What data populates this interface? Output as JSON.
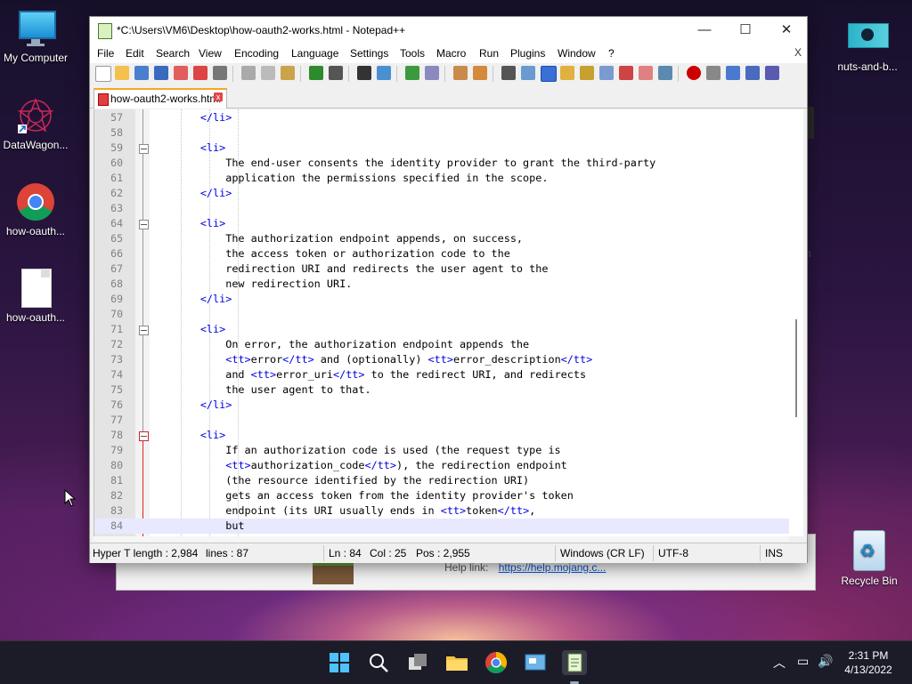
{
  "desktop": {
    "icons": [
      {
        "label": "My Computer",
        "icon": "monitor-icon"
      },
      {
        "label": "DataWagon...",
        "icon": "datawagon-shortcut-icon"
      },
      {
        "label": "how-oauth...",
        "icon": "chrome-icon"
      },
      {
        "label": "how-oauth...",
        "icon": "file-icon"
      },
      {
        "label": "nuts-and-b...",
        "icon": "image-file-icon"
      }
    ],
    "recycle_bin": "Recycle Bin"
  },
  "background_window": {
    "help_label": "Help link:",
    "help_link": "https://help.mojang.c...",
    "edge_text": "n"
  },
  "notepad": {
    "title": "*C:\\Users\\VM6\\Desktop\\how-oauth2-works.html - Notepad++",
    "menu": [
      "File",
      "Edit",
      "Search",
      "View",
      "Encoding",
      "Language",
      "Settings",
      "Tools",
      "Macro",
      "Run",
      "Plugins",
      "Window",
      "?"
    ],
    "menu_close": "X",
    "tab": {
      "name": "how-oauth2-works.html",
      "close": "x"
    },
    "lines": [
      {
        "n": "57",
        "text": "        </li>"
      },
      {
        "n": "58",
        "text": ""
      },
      {
        "n": "59",
        "text": "        <li>"
      },
      {
        "n": "60",
        "text": "            The end-user consents the identity provider to grant the third-party"
      },
      {
        "n": "61",
        "text": "            application the permissions specified in the scope."
      },
      {
        "n": "62",
        "text": "        </li>"
      },
      {
        "n": "63",
        "text": ""
      },
      {
        "n": "64",
        "text": "        <li>"
      },
      {
        "n": "65",
        "text": "            The authorization endpoint appends, on success,"
      },
      {
        "n": "66",
        "text": "            the access token or authorization code to the"
      },
      {
        "n": "67",
        "text": "            redirection URI and redirects the user agent to the"
      },
      {
        "n": "68",
        "text": "            new redirection URI."
      },
      {
        "n": "69",
        "text": "        </li>"
      },
      {
        "n": "70",
        "text": ""
      },
      {
        "n": "71",
        "text": "        <li>"
      },
      {
        "n": "72",
        "text": "            On error, the authorization endpoint appends the"
      },
      {
        "n": "73",
        "text": "            <tt>error</tt> and (optionally) <tt>error_description</tt>"
      },
      {
        "n": "74",
        "text": "            and <tt>error_uri</tt> to the redirect URI, and redirects"
      },
      {
        "n": "75",
        "text": "            the user agent to that."
      },
      {
        "n": "76",
        "text": "        </li>"
      },
      {
        "n": "77",
        "text": ""
      },
      {
        "n": "78",
        "text": "        <li>"
      },
      {
        "n": "79",
        "text": "            If an authorization code is used (the request type is"
      },
      {
        "n": "80",
        "text": "            <tt>authorization_code</tt>), the redirection endpoint"
      },
      {
        "n": "81",
        "text": "            (the resource identified by the redirection URI)"
      },
      {
        "n": "82",
        "text": "            gets an access token from the identity provider's token"
      },
      {
        "n": "83",
        "text": "            endpoint (its URI usually ends in <tt>token</tt>,"
      },
      {
        "n": "84",
        "text": "            but"
      }
    ],
    "status": {
      "type_length": "Hyper T length : 2,984",
      "lines": "lines : 87",
      "ln": "Ln : 84",
      "col": "Col : 25",
      "pos": "Pos : 2,955",
      "eol": "Windows (CR LF)",
      "encoding": "UTF-8",
      "mode": "INS"
    }
  },
  "taskbar": {
    "time": "2:31 PM",
    "date": "4/13/2022"
  }
}
